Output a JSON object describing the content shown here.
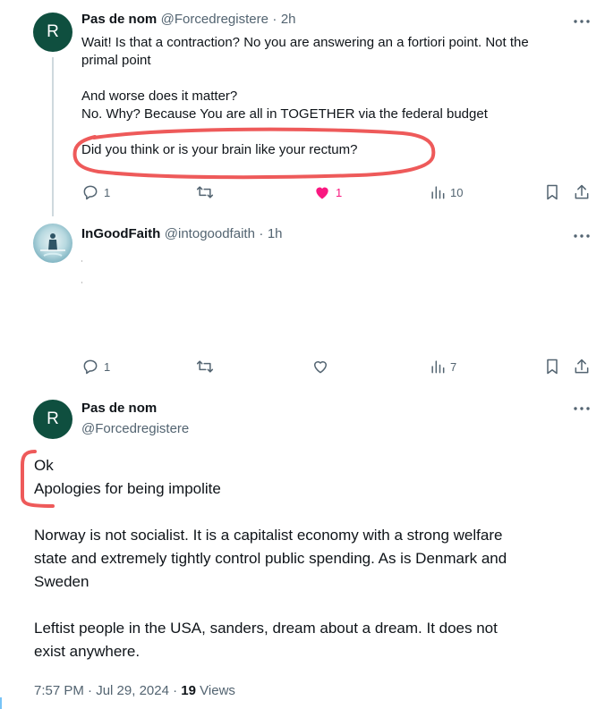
{
  "tweet1": {
    "avatar_letter": "R",
    "name": "Pas de nom",
    "handle": "@Forcedregistere",
    "sep": "·",
    "time": "2h",
    "lines": [
      "Wait! Is that a contraction? No you are answering an a fortiori point. Not the",
      "primal point",
      "And worse does it matter?",
      "No. Why? Because You are all in TOGETHER  via the federal budget",
      "Did you think or is your brain like your rectum?"
    ],
    "replies": "1",
    "likes": "1",
    "views": "10",
    "liked_color": "#f91880"
  },
  "tweet2": {
    "name": "InGoodFaith",
    "handle": "@intogoodfaith",
    "sep": "·",
    "time": "1h",
    "replies": "1",
    "views": "7"
  },
  "main": {
    "avatar_letter": "R",
    "name": "Pas de nom",
    "handle": "@Forcedregistere",
    "paragraphs": [
      "Ok",
      "Apologies for being impolite",
      "Norway is not socialist. It is a capitalist economy with a strong welfare",
      "state and extremely tightly control public spending. As is Denmark and",
      "Sweden",
      "Leftist people in the USA, sanders, dream about a dream. It does not",
      "exist anywhere."
    ],
    "time": "7:57 PM",
    "dot1": "·",
    "date": "Jul 29, 2024",
    "dot2": "·",
    "views_count": "19",
    "views_label": "Views"
  },
  "icons": [
    "reply-icon",
    "retweet-icon",
    "like-icon",
    "views-icon",
    "bookmark-icon",
    "share-icon",
    "more-icon"
  ],
  "colors": {
    "annotation_red": "#ee5a5a",
    "avatar_green": "#0f4f3f",
    "muted": "#536471"
  }
}
